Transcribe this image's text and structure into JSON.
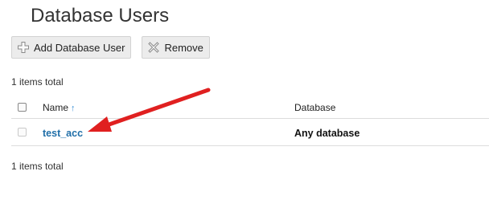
{
  "header": {
    "title": "Database Users"
  },
  "toolbar": {
    "add_label": "Add Database User",
    "add_icon": "plus-icon",
    "remove_label": "Remove",
    "remove_icon": "close-x-icon"
  },
  "summary": {
    "total_top": "1 items total",
    "total_bottom": "1 items total"
  },
  "table": {
    "columns": {
      "name": "Name",
      "name_sort_indicator": "↑",
      "database": "Database"
    },
    "rows": [
      {
        "name": "test_acc",
        "database": "Any database"
      }
    ]
  },
  "annotation": {
    "arrow_color": "#e02020"
  }
}
